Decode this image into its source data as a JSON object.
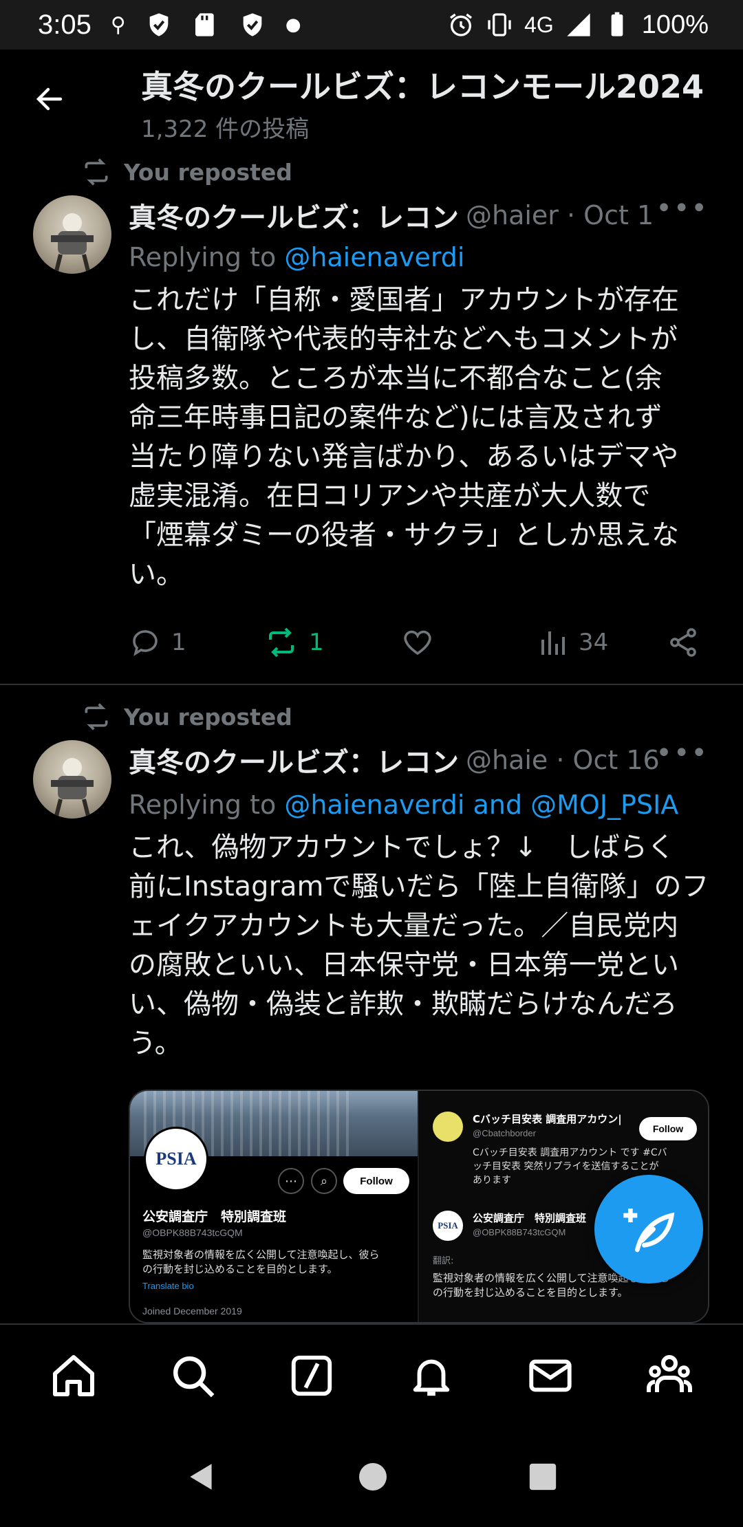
{
  "status_bar": {
    "time": "3:05",
    "network": "4G",
    "battery": "100%"
  },
  "header": {
    "title": "真冬のクールビズ：レコンモール2024",
    "subtitle": "1,322 件の投稿"
  },
  "tweets": [
    {
      "repost_label": "You reposted",
      "name": "真冬のクールビズ：レコン",
      "meta": "@haier · Oct 1",
      "replying_prefix": "Replying to ",
      "replying_to": "@haienaverdi",
      "text": "これだけ「自称・愛国者」アカウントが存在\nし、自衛隊や代表的寺社などへもコメントが\n投稿多数。ところが本当に不都合なこと(余\n命三年時事日記の案件など)には言及されず\n当たり障りない発言ばかり、あるいはデマや\n虚実混淆。在日コリアンや共産が大人数で\n「煙幕ダミーの役者・サクラ」としか思えな\nい。",
      "replies": "1",
      "reposts": "1",
      "views": "34"
    },
    {
      "repost_label": "You reposted",
      "name": "真冬のクールビズ：レコン",
      "meta": "@haie · Oct 16",
      "replying_prefix": "Replying to ",
      "replying_to": "@haienaverdi and @MOJ_PSIA",
      "text": "これ、偽物アカウントでしょ？↓　しばらく\n前にInstagramで騒いだら「陸上自衛隊」のフ\nェイクアカウントも大量だった。／自民党内\nの腐敗といい、日本保守党・日本第一党とい\nい、偽物・偽装と詐欺・欺瞞だらけなんだろ\nう。"
    }
  ],
  "media": {
    "logo": "PSIA",
    "follow": "Follow",
    "name": "公安調査庁　特別調査班",
    "handle": "@OBPK88B743tcGQM",
    "bio": "監視対象者の情報を広く公開して注意喚起し、彼ら\nの行動を封じ込めることを目的とします。",
    "translate": "Translate bio",
    "joined": "Joined December 2019",
    "r_name1": "Cバッチ目安表 調査用アカウン|",
    "r_handle1": "@Cbatchborder",
    "r_follow": "Follow",
    "r_text1": "Cバッチ目安表 調査用アカウント です #Cバ\nッチ目安表 突然リプライを送信することが\nあります",
    "r_name2": "公安調査庁　特別調査班",
    "r_handle2": "@OBPK88B743tcGQM",
    "r_text2": "翻訳:",
    "r_text3": "監視対象者の情報を広く公開して注意喚起し、彼ら\nの行動を封じ込めることを目的とします。"
  },
  "colors": {
    "accent": "#1d9bf0",
    "repost_active": "#00ba7c",
    "muted": "#71767b",
    "background": "#000000"
  }
}
